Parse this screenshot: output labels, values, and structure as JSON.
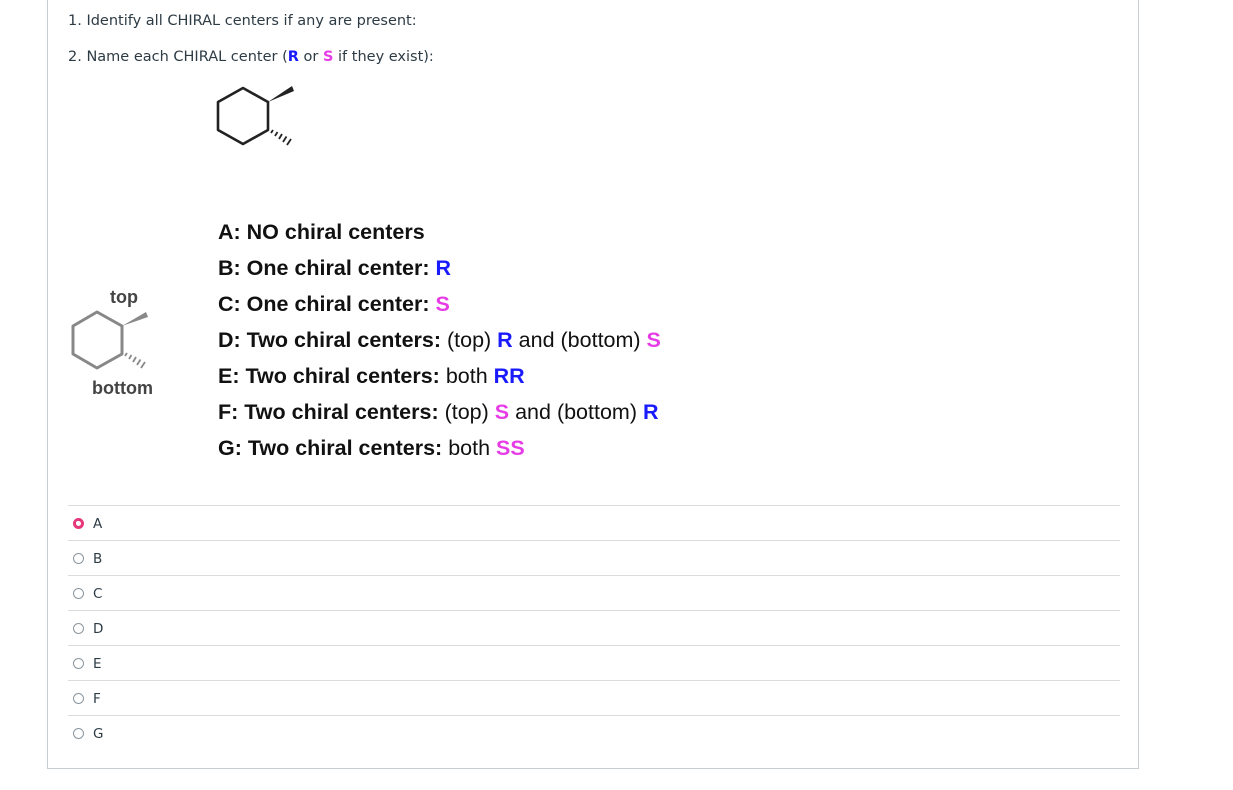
{
  "question": {
    "line1": "1. Identify all CHIRAL centers if any are present:",
    "line2_prefix": "2. Name each CHIRAL center (",
    "line2_r": "R",
    "line2_or": " or ",
    "line2_s": "S",
    "line2_suffix": " if they exist):"
  },
  "diagram": {
    "top_label": "top",
    "bottom_label": "bottom"
  },
  "answer_key": [
    {
      "head": "A: NO chiral centers",
      "parts": []
    },
    {
      "head": "B: One chiral center: ",
      "parts": [
        {
          "t": "R",
          "c": "r"
        }
      ]
    },
    {
      "head": "C: One chiral center: ",
      "parts": [
        {
          "t": "S",
          "c": "s"
        }
      ]
    },
    {
      "head": "D: Two chiral centers: ",
      "parts": [
        {
          "t": "(top) ",
          "c": ""
        },
        {
          "t": "R",
          "c": "r"
        },
        {
          "t": " and (bottom) ",
          "c": ""
        },
        {
          "t": "S",
          "c": "s"
        }
      ]
    },
    {
      "head": "E: Two chiral centers: ",
      "parts": [
        {
          "t": "both ",
          "c": ""
        },
        {
          "t": "RR",
          "c": "r"
        }
      ]
    },
    {
      "head": "F: Two chiral centers: ",
      "parts": [
        {
          "t": "(top) ",
          "c": ""
        },
        {
          "t": "S",
          "c": "s"
        },
        {
          "t": " and (bottom) ",
          "c": ""
        },
        {
          "t": "R",
          "c": "r"
        }
      ]
    },
    {
      "head": "G: Two chiral centers: ",
      "parts": [
        {
          "t": "both ",
          "c": ""
        },
        {
          "t": "SS",
          "c": "s"
        }
      ]
    }
  ],
  "choices": [
    {
      "label": "A",
      "selected": true
    },
    {
      "label": "B",
      "selected": false
    },
    {
      "label": "C",
      "selected": false
    },
    {
      "label": "D",
      "selected": false
    },
    {
      "label": "E",
      "selected": false
    },
    {
      "label": "F",
      "selected": false
    },
    {
      "label": "G",
      "selected": false
    }
  ],
  "colors": {
    "r": "#1a1aff",
    "s": "#e63ce6",
    "selected_radio": "#e4387a"
  }
}
